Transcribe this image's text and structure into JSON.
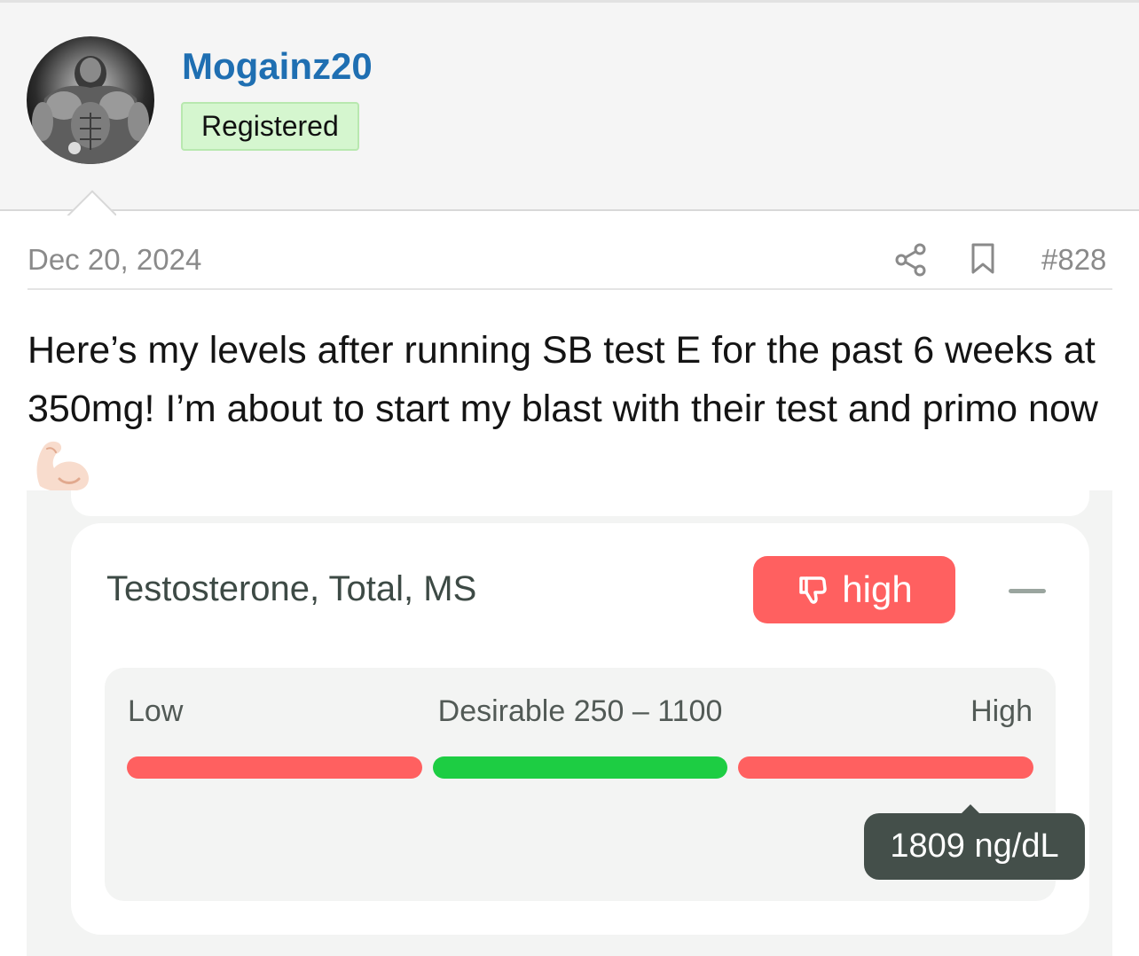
{
  "user": {
    "username": "Mogainz20",
    "role": "Registered"
  },
  "post": {
    "date": "Dec 20, 2024",
    "number": "#828",
    "body": "Here’s my levels after running SB test E for the past 6 weeks at 350mg! I’m about to start my blast with their test and primo now",
    "emoji": "flexed-biceps-icon"
  },
  "lab_result": {
    "test_name": "Testosterone, Total, MS",
    "status": "high",
    "range": {
      "low_label": "Low",
      "desirable_label": "Desirable 250 – 1100",
      "high_label": "High"
    },
    "value_text": "1809 ng/dL",
    "value": 1809,
    "unit": "ng/dL",
    "desirable_min": 250,
    "desirable_max": 1100
  },
  "colors": {
    "username": "#1f6fb2",
    "badge_bg": "#d5f6cf",
    "range_red": "#ff6060",
    "range_green": "#1dcd43",
    "tooltip_bg": "#444f4a"
  }
}
